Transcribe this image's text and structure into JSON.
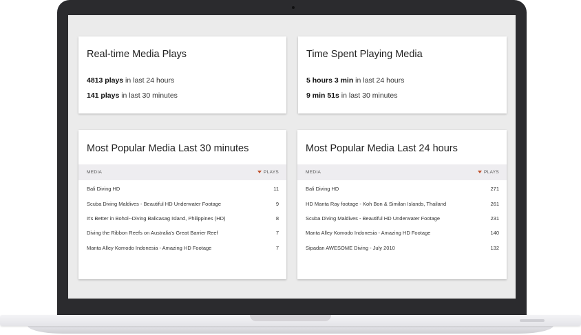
{
  "cards": {
    "realtime": {
      "title": "Real-time Media Plays",
      "line1_value": "4813 plays",
      "line1_suffix": " in last 24 hours",
      "line2_value": "141 plays",
      "line2_suffix": " in last 30 minutes"
    },
    "timespent": {
      "title": "Time Spent Playing Media",
      "line1_value": "5 hours 3 min",
      "line1_suffix": " in last 24 hours",
      "line2_value": "9 min 51s",
      "line2_suffix": " in last 30 minutes"
    },
    "popular30": {
      "title": "Most Popular Media Last 30 minutes",
      "col_media": "MEDIA",
      "col_plays": "PLAYS",
      "rows": [
        {
          "name": "Bali Diving HD",
          "plays": "11"
        },
        {
          "name": "Scuba Diving Maldives - Beautiful HD Underwater Footage",
          "plays": "9"
        },
        {
          "name": "It's Better in Bohol--Diving Balicasag Island, Philippines (HD)",
          "plays": "8"
        },
        {
          "name": "Diving the Ribbon Reefs on Australia's Great Barrier Reef",
          "plays": "7"
        },
        {
          "name": "Manta Alley Komodo Indonesia - Amazing HD Footage",
          "plays": "7"
        }
      ]
    },
    "popular24": {
      "title": "Most Popular Media Last 24 hours",
      "col_media": "MEDIA",
      "col_plays": "PLAYS",
      "rows": [
        {
          "name": "Bali Diving HD",
          "plays": "271"
        },
        {
          "name": "HD Manta Ray footage - Koh Bon & Similan Islands, Thailand",
          "plays": "261"
        },
        {
          "name": "Scuba Diving Maldives - Beautiful HD Underwater Footage",
          "plays": "231"
        },
        {
          "name": "Manta Alley Komodo Indonesia - Amazing HD Footage",
          "plays": "140"
        },
        {
          "name": "Sipadan AWESOME Diving - July 2010",
          "plays": "132"
        }
      ]
    }
  },
  "colors": {
    "sort_arrow": "#c0502a",
    "header_bg": "#eeedf0",
    "screen_bg": "#ebebeb",
    "bezel": "#2b2b2e"
  },
  "icons": {
    "sort": "sort-desc-arrow-icon"
  }
}
